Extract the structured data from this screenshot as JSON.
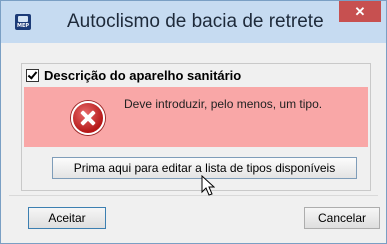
{
  "window": {
    "title": "Autoclismo de bacia de retrete",
    "app_icon_text": "MEP",
    "close_icon": "close-icon"
  },
  "group": {
    "checked": true,
    "label": "Descrição do aparelho sanitário"
  },
  "error": {
    "icon": "error-icon",
    "message": "Deve introduzir, pelo menos, um tipo."
  },
  "buttons": {
    "edit_types": "Prima aqui para editar a lista de tipos disponíveis",
    "accept": "Aceitar",
    "cancel": "Cancelar"
  },
  "colors": {
    "titlebar": "#c6dbf1",
    "close": "#c75050",
    "error_panel": "#f9a7a7"
  }
}
